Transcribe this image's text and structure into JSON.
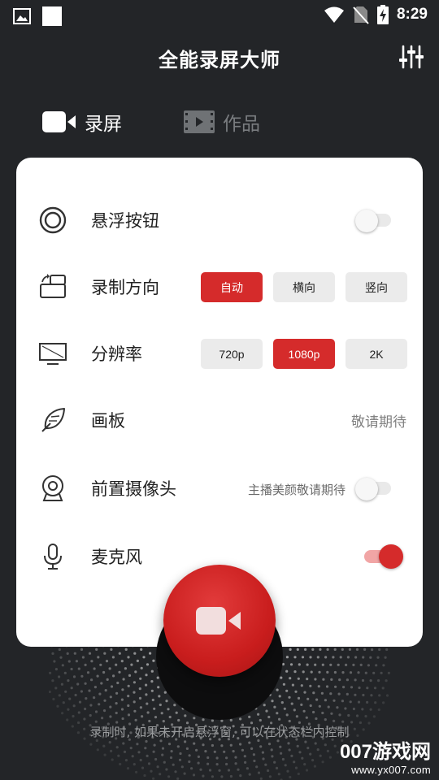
{
  "status_bar": {
    "time": "8:29"
  },
  "app": {
    "title": "全能录屏大师"
  },
  "tabs": [
    {
      "label": "录屏",
      "icon": "video-camera-icon",
      "active": true
    },
    {
      "label": "作品",
      "icon": "film-strip-icon",
      "active": false
    }
  ],
  "settings": {
    "floating_button": {
      "label": "悬浮按钮",
      "enabled": false
    },
    "orientation": {
      "label": "录制方向",
      "options": [
        "自动",
        "横向",
        "竖向"
      ],
      "selected": "自动"
    },
    "resolution": {
      "label": "分辨率",
      "options": [
        "720p",
        "1080p",
        "2K"
      ],
      "selected": "1080p"
    },
    "canvas": {
      "label": "画板",
      "hint": "敬请期待"
    },
    "front_camera": {
      "label": "前置摄像头",
      "hint": "主播美颜敬请期待",
      "enabled": false
    },
    "microphone": {
      "label": "麦克风",
      "enabled": true
    }
  },
  "footer": {
    "text": "录制时, 如果未开启悬浮窗, 可以在状态栏内控制"
  },
  "watermark": {
    "brand": "007游戏网",
    "url": "www.yx007.com"
  },
  "colors": {
    "accent": "#d52b2b",
    "background": "#232528",
    "card": "#ffffff"
  }
}
